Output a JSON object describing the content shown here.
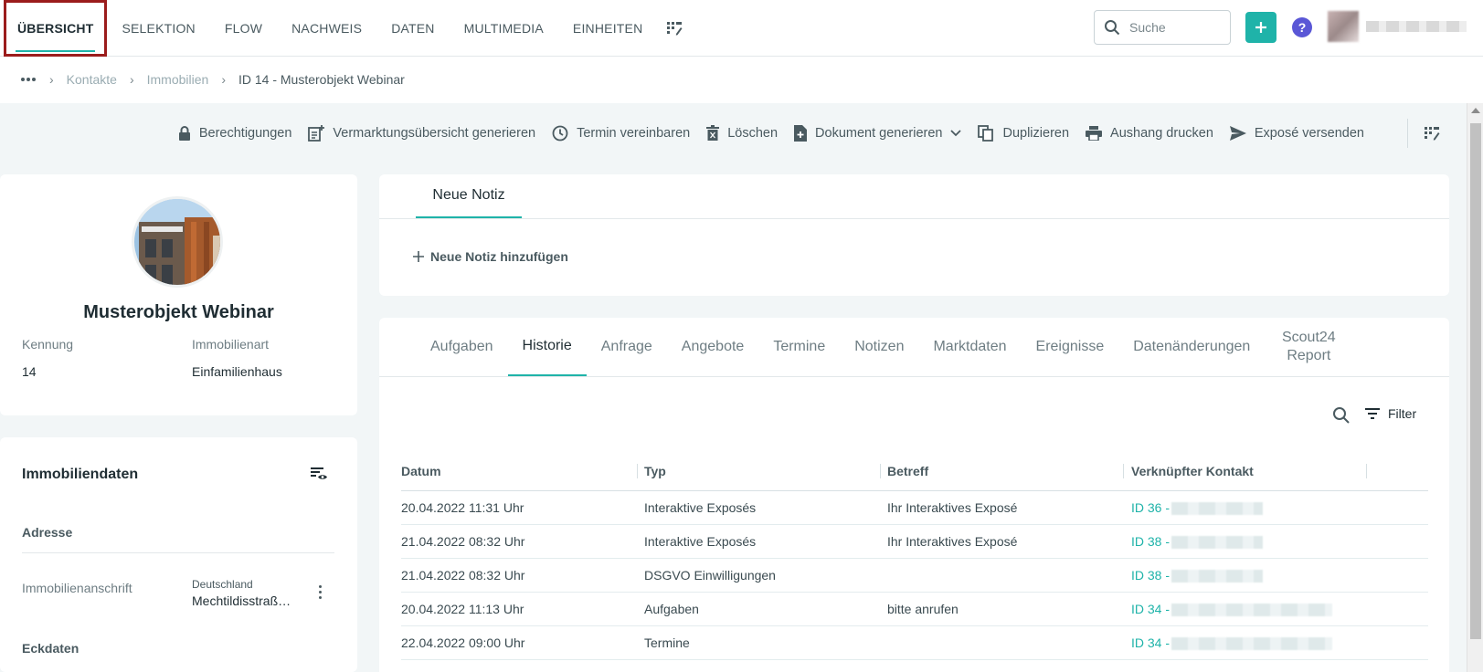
{
  "nav": {
    "tabs": [
      {
        "label": "ÜBERSICHT",
        "active": true
      },
      {
        "label": "SELEKTION"
      },
      {
        "label": "FLOW"
      },
      {
        "label": "NACHWEIS"
      },
      {
        "label": "DATEN"
      },
      {
        "label": "MULTIMEDIA"
      },
      {
        "label": "EINHEITEN"
      }
    ],
    "search_placeholder": "Suche",
    "help_label": "?"
  },
  "breadcrumb": {
    "items": [
      "Kontakte",
      "Immobilien"
    ],
    "current": "ID 14 - Musterobjekt Webinar"
  },
  "toolbar": {
    "permissions": "Berechtigungen",
    "marketing": "Vermarktungsübersicht generieren",
    "appointment": "Termin vereinbaren",
    "delete": "Löschen",
    "document": "Dokument generieren",
    "duplicate": "Duplizieren",
    "print": "Aushang drucken",
    "send": "Exposé versenden"
  },
  "profile": {
    "title": "Musterobjekt Webinar",
    "id_label": "Kennung",
    "id_value": "14",
    "type_label": "Immobilienart",
    "type_value": "Einfamilienhaus"
  },
  "property_data": {
    "title": "Immobiliendaten",
    "section_address": "Adresse",
    "address_label": "Immobilienanschrift",
    "address_country": "Deutschland",
    "address_street": "Mechtildisstraß…",
    "section_key": "Eckdaten"
  },
  "notes": {
    "tab": "Neue Notiz",
    "add": "Neue Notiz hinzufügen"
  },
  "history": {
    "tabs": [
      {
        "label": "Aufgaben"
      },
      {
        "label": "Historie",
        "active": true
      },
      {
        "label": "Anfrage"
      },
      {
        "label": "Angebote"
      },
      {
        "label": "Termine"
      },
      {
        "label": "Notizen"
      },
      {
        "label": "Marktdaten"
      },
      {
        "label": "Ereignisse"
      },
      {
        "label": "Datenänderungen"
      },
      {
        "label": "Scout24 Report"
      }
    ],
    "filter_label": "Filter",
    "columns": [
      "Datum",
      "Typ",
      "Betreff",
      "Verknüpfter Kontakt"
    ],
    "rows": [
      {
        "date": "20.04.2022 11:31 Uhr",
        "type": "Interaktive Exposés",
        "subject": "Ihr Interaktives Exposé",
        "contact": "ID 36 -"
      },
      {
        "date": "21.04.2022 08:32 Uhr",
        "type": "Interaktive Exposés",
        "subject": "Ihr Interaktives Exposé",
        "contact": "ID 38 -"
      },
      {
        "date": "21.04.2022 08:32 Uhr",
        "type": "DSGVO Einwilligungen",
        "subject": "",
        "contact": "ID 38 -"
      },
      {
        "date": "20.04.2022 11:13 Uhr",
        "type": "Aufgaben",
        "subject": "bitte anrufen",
        "contact": "ID 34 -"
      },
      {
        "date": "22.04.2022 09:00 Uhr",
        "type": "Termine",
        "subject": "",
        "contact": "ID 34 -"
      }
    ]
  },
  "colors": {
    "accent": "#1fb3a9",
    "highlight_border": "#9b1c1c",
    "help": "#5a57d6",
    "workspace": "#f2f6f7"
  }
}
